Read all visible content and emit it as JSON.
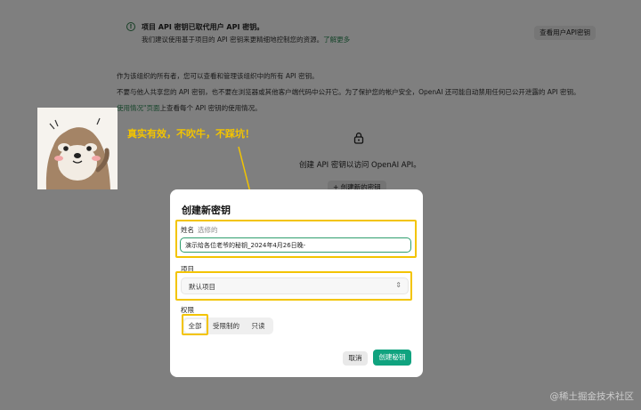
{
  "background": {
    "notice": {
      "title": "项目 API 密钥已取代用户 API 密钥。",
      "desc": "我们建议使用基于项目的 API 密钥来更精细地控制您的资源。",
      "link": "了解更多",
      "button": "查看用户API密钥"
    },
    "para1": "作为该组织的所有者，您可以查看和管理该组织中的所有 API 密钥。",
    "para2": "不要与他人共享您的 API 密钥，也不要在浏览器或其他客户端代码中公开它。为了保护您的帐户安全，OpenAI 还可能自动禁用任何已公开泄露的 API 密钥。",
    "para3_link": "使用情况\"页面",
    "para3_rest": "上查看每个 API 密钥的使用情况。",
    "empty_text": "创建 API 密钥以访问 OpenAI API。",
    "create_button": "+ 创建新的密钥"
  },
  "annotation": {
    "caption": "真实有效，不吹牛，不踩坑！"
  },
  "modal": {
    "title": "创建新密钥",
    "name_label": "姓名",
    "name_optional": "选修的",
    "name_value": "演示给各位老爷的秘钥_2024年4月26日晚-",
    "project_label": "项目",
    "project_value": "默认项目",
    "permissions_label": "权限",
    "permissions": {
      "all": "全部",
      "limited": "受限制的",
      "readonly": "只读"
    },
    "cancel": "取消",
    "create": "创建秘钥"
  },
  "watermark": "@稀土掘金技术社区",
  "colors": {
    "accent": "#10a37f",
    "highlight": "#f3c400"
  }
}
